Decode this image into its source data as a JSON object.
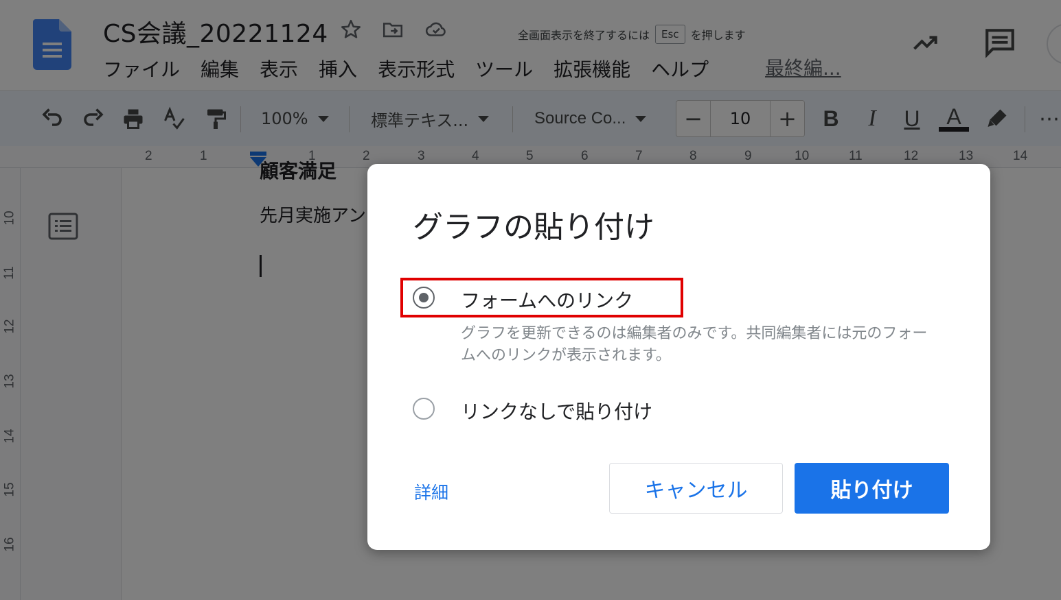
{
  "window": {
    "doc_title": "CS会議_20221124",
    "last_edit": "最終編..."
  },
  "menu": [
    "ファイル",
    "編集",
    "表示",
    "挿入",
    "表示形式",
    "ツール",
    "拡張機能",
    "ヘルプ"
  ],
  "fullscreen_toast": {
    "before": "全画面表示を終了するには",
    "key": "Esc",
    "after": "を押します"
  },
  "toolbar": {
    "zoom": "100%",
    "style": "標準テキス...",
    "font": "Source Co...",
    "font_size": "10",
    "minus": "−",
    "plus": "+",
    "bold": "B",
    "italic": "I",
    "underline": "U",
    "text_color": "A",
    "more": "⋯"
  },
  "ruler": {
    "horizontal": [
      "2",
      "1",
      "1",
      "2",
      "3",
      "4",
      "5",
      "6",
      "7",
      "8",
      "9",
      "10",
      "11",
      "12",
      "13",
      "14"
    ],
    "vertical": [
      "10",
      "11",
      "12",
      "13",
      "14",
      "15",
      "16"
    ]
  },
  "document": {
    "heading": "顧客満足",
    "line1": "先月実施アン"
  },
  "dialog": {
    "title": "グラフの貼り付け",
    "option_link": {
      "label": "フォームへのリンク",
      "description": "グラフを更新できるのは編集者のみです。共同編集者には元のフォームへのリンクが表示されます。",
      "selected": true
    },
    "option_nolink": {
      "label": "リンクなしで貼り付け",
      "selected": false
    },
    "details": "詳細",
    "cancel": "キャンセル",
    "paste": "貼り付け"
  },
  "colors": {
    "accent": "#1a73e8",
    "highlight": "#e00000",
    "doc_blue": "#4285f4"
  }
}
